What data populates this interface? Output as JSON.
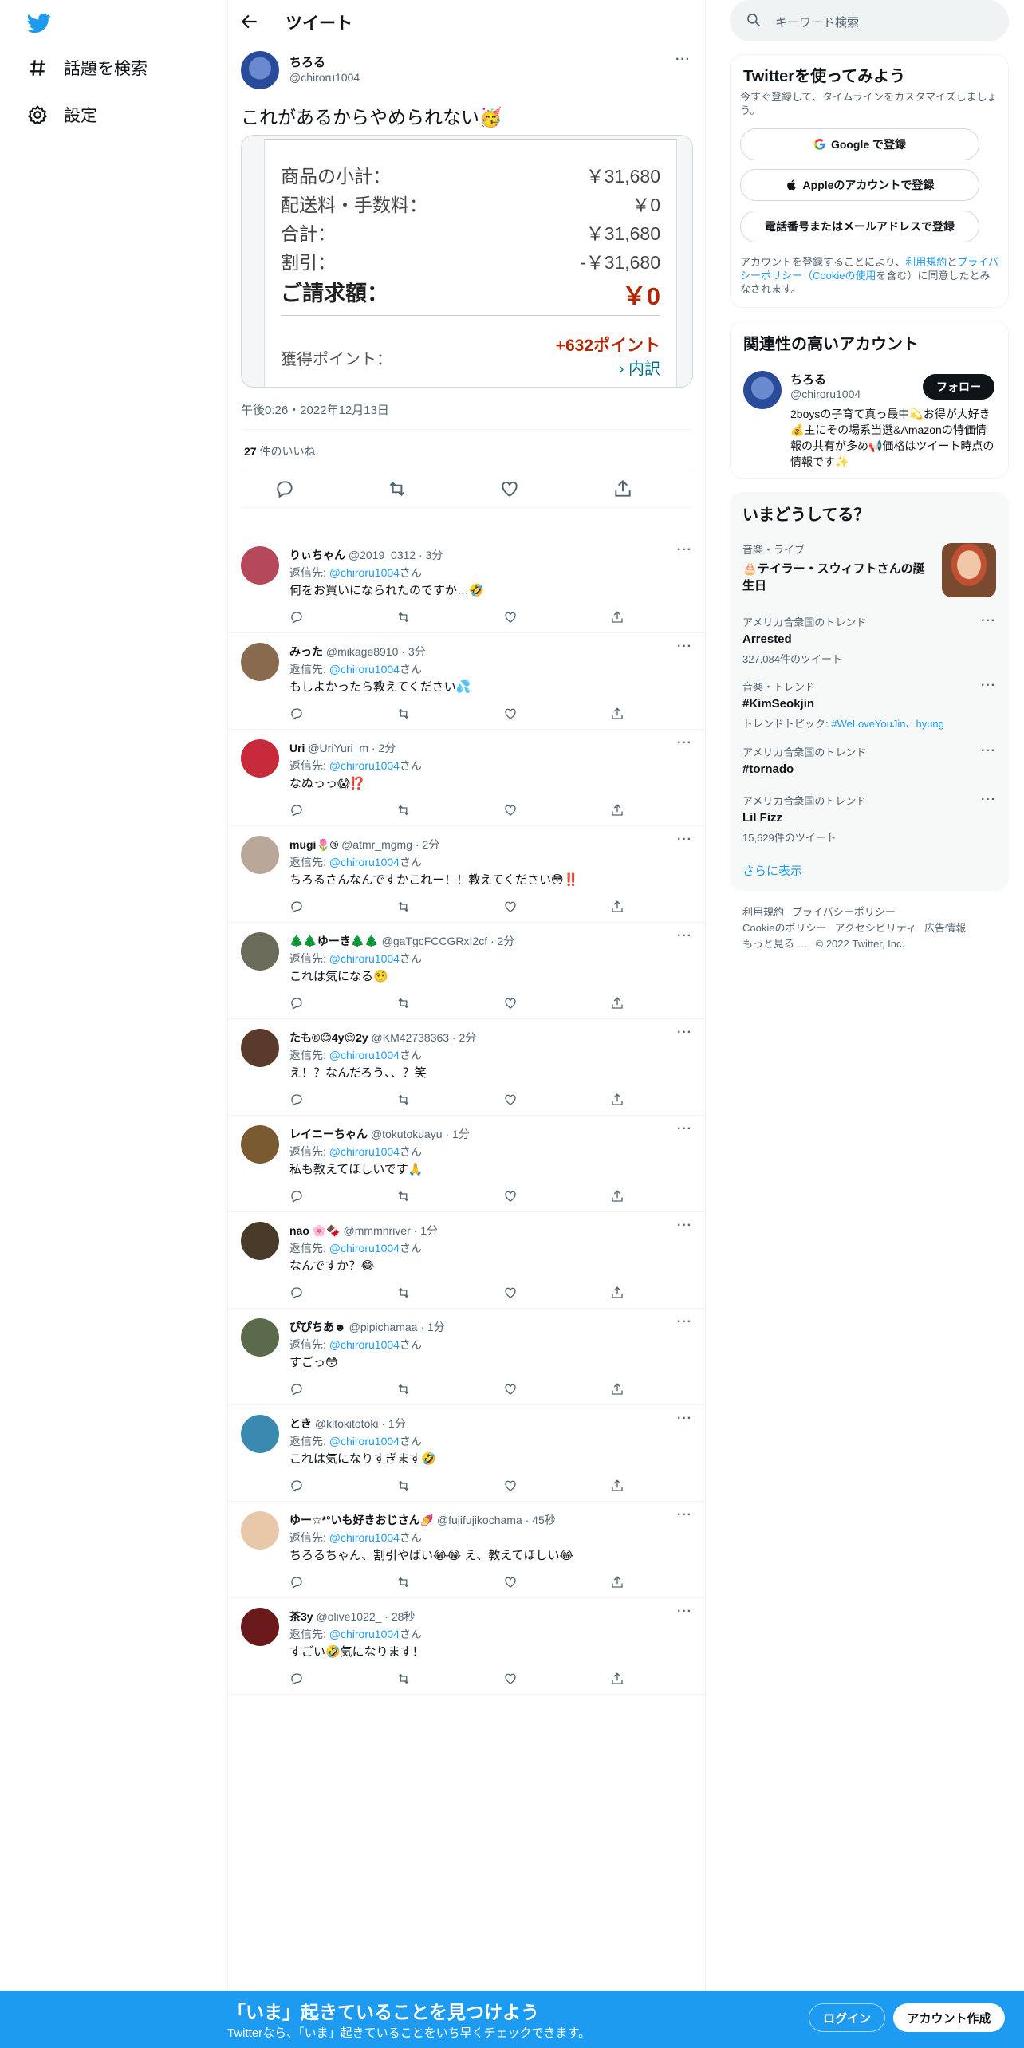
{
  "nav": {
    "logo": "twitter-bird-icon",
    "explore_label": "話題を検索",
    "settings_label": "設定"
  },
  "header": {
    "title": "ツイート"
  },
  "tweet": {
    "author_name": "ちろる",
    "author_handle": "@chiroru1004",
    "text": "これがあるからやめられない🥳",
    "receipt": {
      "subtotal_label": "商品の小計：",
      "subtotal_value": "￥31,680",
      "shipping_label": "配送料・手数料：",
      "shipping_value": "￥0",
      "total_label": "合計：",
      "total_value": "￥31,680",
      "discount_label": "割引：",
      "discount_value": "-￥31,680",
      "billing_label": "ご請求額：",
      "billing_value": "￥0",
      "points_label": "獲得ポイント：",
      "points_value": "+632ポイント",
      "points_link": "› 内訳"
    },
    "timestamp": "午後0:26・2022年12月13日",
    "likes_count": "27",
    "likes_label": " 件のいいね"
  },
  "reply_prefix": "返信先: ",
  "reply_suffix": "さん",
  "reply_target": "@chiroru1004",
  "replies": [
    {
      "name": "りぃちゃん",
      "meta": " @2019_0312 · 3分",
      "text": "何をお買いになられたのですか…🤣",
      "avatar": "#b5485a"
    },
    {
      "name": "みった",
      "meta": " @mikage8910 · 3分",
      "text": "もしよかったら教えてください💦",
      "avatar": "#8a6a4f"
    },
    {
      "name": "Uri",
      "meta": " @UriYuri_m · 2分",
      "text": "なぬっっ😱⁉️",
      "avatar": "#c72a3a"
    },
    {
      "name": "mugi🌷®",
      "meta": " @atmr_mgmg · 2分",
      "text": "ちろるさんなんですかこれー！！教えてください😳‼️",
      "avatar": "#b9a89a"
    },
    {
      "name": "🌲🌲ゆーき🌲🌲",
      "meta": " @gaTgcFCCGRxI2cf · 2分",
      "text": "これは気になる🤨",
      "avatar": "#6b6b5a"
    },
    {
      "name": "たも®😊4y😌2y",
      "meta": " @KM42738363 · 2分",
      "text": "え！？なんだろう、、？笑",
      "avatar": "#5a3a2a"
    },
    {
      "name": "レイニーちゃん",
      "meta": " @tokutokuayu · 1分",
      "text": "私も教えてほしいです🙏",
      "avatar": "#7a5a30"
    },
    {
      "name": "nao 🌸🍫",
      "meta": " @mmmnriver · 1分",
      "text": "なんですか？😂",
      "avatar": "#4a3a2a"
    },
    {
      "name": "ぴぴちあ☻",
      "meta": " @pipichamaa · 1分",
      "text": "すごっ😳",
      "avatar": "#5a6a4a"
    },
    {
      "name": "とき",
      "meta": " @kitokitotoki · 1分",
      "text": "これは気になりすぎます🤣",
      "avatar": "#3a8ab0"
    },
    {
      "name": "ゆー☆*°いも好きおじさん🍠",
      "meta": " @fujifujikochama · 45秒",
      "text": "ちろるちゃん、割引やばい😂😂 え、教えてほしい😂",
      "avatar": "#e8c8a8"
    },
    {
      "name": "茶3y",
      "meta": " @olive1022_ · 28秒",
      "text": "すごい🤣気になります！",
      "avatar": "#6a1a1a"
    }
  ],
  "right": {
    "search_placeholder": "キーワード検索",
    "signup": {
      "title": "Twitterを使ってみよう",
      "subtitle": "今すぐ登録して、タイムラインをカスタマイズしましょう。",
      "google_label": "Google で登録",
      "apple_label": "Appleのアカウントで登録",
      "phone_label": "電話番号またはメールアドレスで登録",
      "legal_1": "アカウントを登録することにより、",
      "legal_terms": "利用規約",
      "legal_2": "と",
      "legal_privacy": "プライバシーポリシー（Cookieの使用",
      "legal_3": "を含む）に同意したとみなされます。"
    },
    "related": {
      "title": "関連性の高いアカウント",
      "name": "ちろる",
      "handle": "@chiroru1004",
      "follow_label": "フォロー",
      "bio": "2boysの子育て真っ最中💫お得が大好き💰主にその場系当選&Amazonの特価情報の共有が多め📢価格はツイート時点の情報です✨"
    },
    "trends": {
      "title": "いまどうしてる？",
      "items": [
        {
          "category": "音楽・ライブ",
          "name": "🎂テイラー・スウィフトさんの誕生日",
          "count": ""
        },
        {
          "category": "アメリカ合衆国のトレンド",
          "name": "Arrested",
          "count": "327,084件のツイート"
        },
        {
          "category": "音楽・トレンド",
          "name": "#KimSeokjin",
          "count": "トレンドトピック: ",
          "extra": "#WeLoveYouJin、hyung"
        },
        {
          "category": "アメリカ合衆国のトレンド",
          "name": "#tornado",
          "count": ""
        },
        {
          "category": "アメリカ合衆国のトレンド",
          "name": "Lil Fizz",
          "count": "15,629件のツイート"
        }
      ],
      "show_more": "さらに表示"
    },
    "footer": {
      "terms": "利用規約",
      "privacy": "プライバシーポリシー",
      "cookie": "Cookieのポリシー",
      "accessibility": "アクセシビリティ",
      "ads": "広告情報",
      "more": "もっと見る …",
      "copyright": "© 2022 Twitter, Inc."
    }
  },
  "banner": {
    "title": "「いま」起きていることを見つけよう",
    "subtitle": "Twitterなら、「いま」起きていることをいち早くチェックできます。",
    "login_label": "ログイン",
    "signup_label": "アカウント作成"
  },
  "colors": {
    "accent": "#1d9bf0",
    "text": "#0f1419",
    "muted": "#536471",
    "receipt_red": "#b12704"
  }
}
